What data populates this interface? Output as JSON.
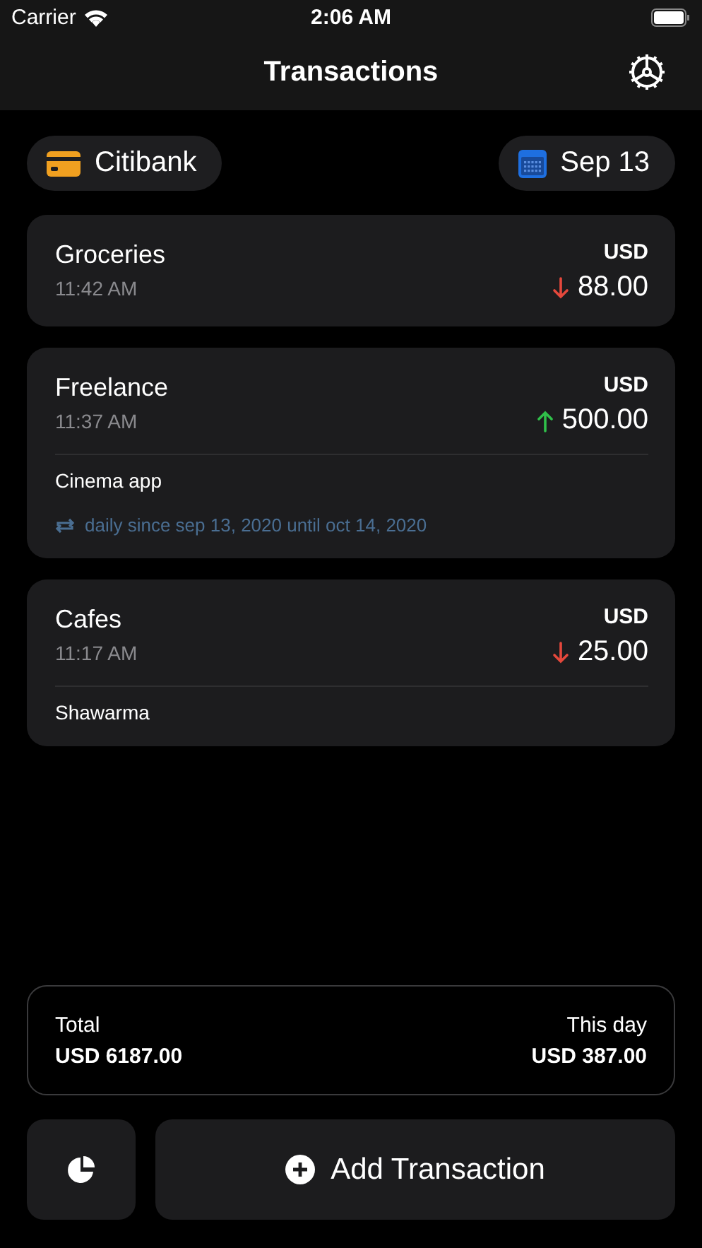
{
  "status_bar": {
    "carrier": "Carrier",
    "time": "2:06 AM"
  },
  "nav": {
    "title": "Transactions"
  },
  "filters": {
    "account": "Citibank",
    "date": "Sep 13"
  },
  "transactions": [
    {
      "category": "Groceries",
      "time": "11:42 AM",
      "currency": "USD",
      "kind": "expense",
      "amount": "88.00"
    },
    {
      "category": "Freelance",
      "time": "11:37 AM",
      "currency": "USD",
      "kind": "income",
      "amount": "500.00",
      "note": "Cinema app",
      "repeat": "daily since sep 13, 2020 until oct 14, 2020"
    },
    {
      "category": "Cafes",
      "time": "11:17 AM",
      "currency": "USD",
      "kind": "expense",
      "amount": "25.00",
      "note": "Shawarma"
    }
  ],
  "summary": {
    "total_label": "Total",
    "total": "USD 6187.00",
    "day_label": "This day",
    "day": "USD 387.00"
  },
  "add_button": "Add Transaction"
}
